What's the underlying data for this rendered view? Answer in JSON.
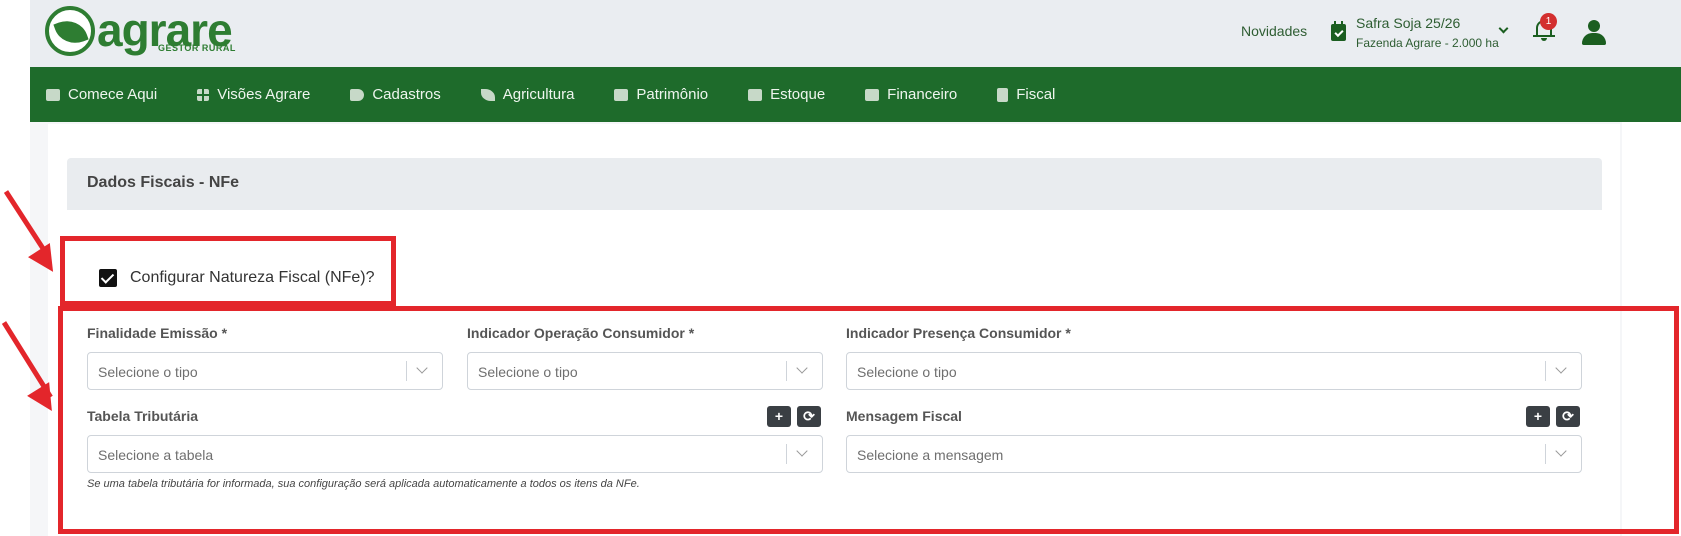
{
  "header": {
    "logo_text": "agrare",
    "logo_subtitle": "GESTOR RURAL",
    "novidades": "Novidades",
    "safra": "Safra Soja 25/26",
    "fazenda": "Fazenda Agrare - 2.000 ha",
    "notification_count": "1"
  },
  "nav": {
    "items": [
      {
        "label": "Comece Aqui",
        "icon": "handshake-icon"
      },
      {
        "label": "Visões Agrare",
        "icon": "dashboard-icon"
      },
      {
        "label": "Cadastros",
        "icon": "tag-icon"
      },
      {
        "label": "Agricultura",
        "icon": "leaf-icon"
      },
      {
        "label": "Patrimônio",
        "icon": "tractor-icon"
      },
      {
        "label": "Estoque",
        "icon": "boxes-icon"
      },
      {
        "label": "Financeiro",
        "icon": "hand-money-icon"
      },
      {
        "label": "Fiscal",
        "icon": "document-icon"
      }
    ]
  },
  "section": {
    "title": "Dados Fiscais - NFe",
    "checkbox_label": "Configurar Natureza Fiscal (NFe)?",
    "checkbox_checked": true
  },
  "form": {
    "finalidade_label": "Finalidade Emissão *",
    "finalidade_placeholder": "Selecione o tipo",
    "operacao_label": "Indicador Operação Consumidor *",
    "operacao_placeholder": "Selecione o tipo",
    "presenca_label": "Indicador Presença Consumidor *",
    "presenca_placeholder": "Selecione o tipo",
    "tabela_label": "Tabela Tributária",
    "tabela_placeholder": "Selecione a tabela",
    "mensagem_label": "Mensagem Fiscal",
    "mensagem_placeholder": "Selecione a mensagem",
    "add_symbol": "+",
    "refresh_symbol": "⟳",
    "hint": "Se uma tabela tributária for informada, sua configuração será aplicada automaticamente a todos os itens da NFe."
  },
  "colors": {
    "brand_green": "#1e6b2b",
    "annotation_red": "#e3262b"
  }
}
